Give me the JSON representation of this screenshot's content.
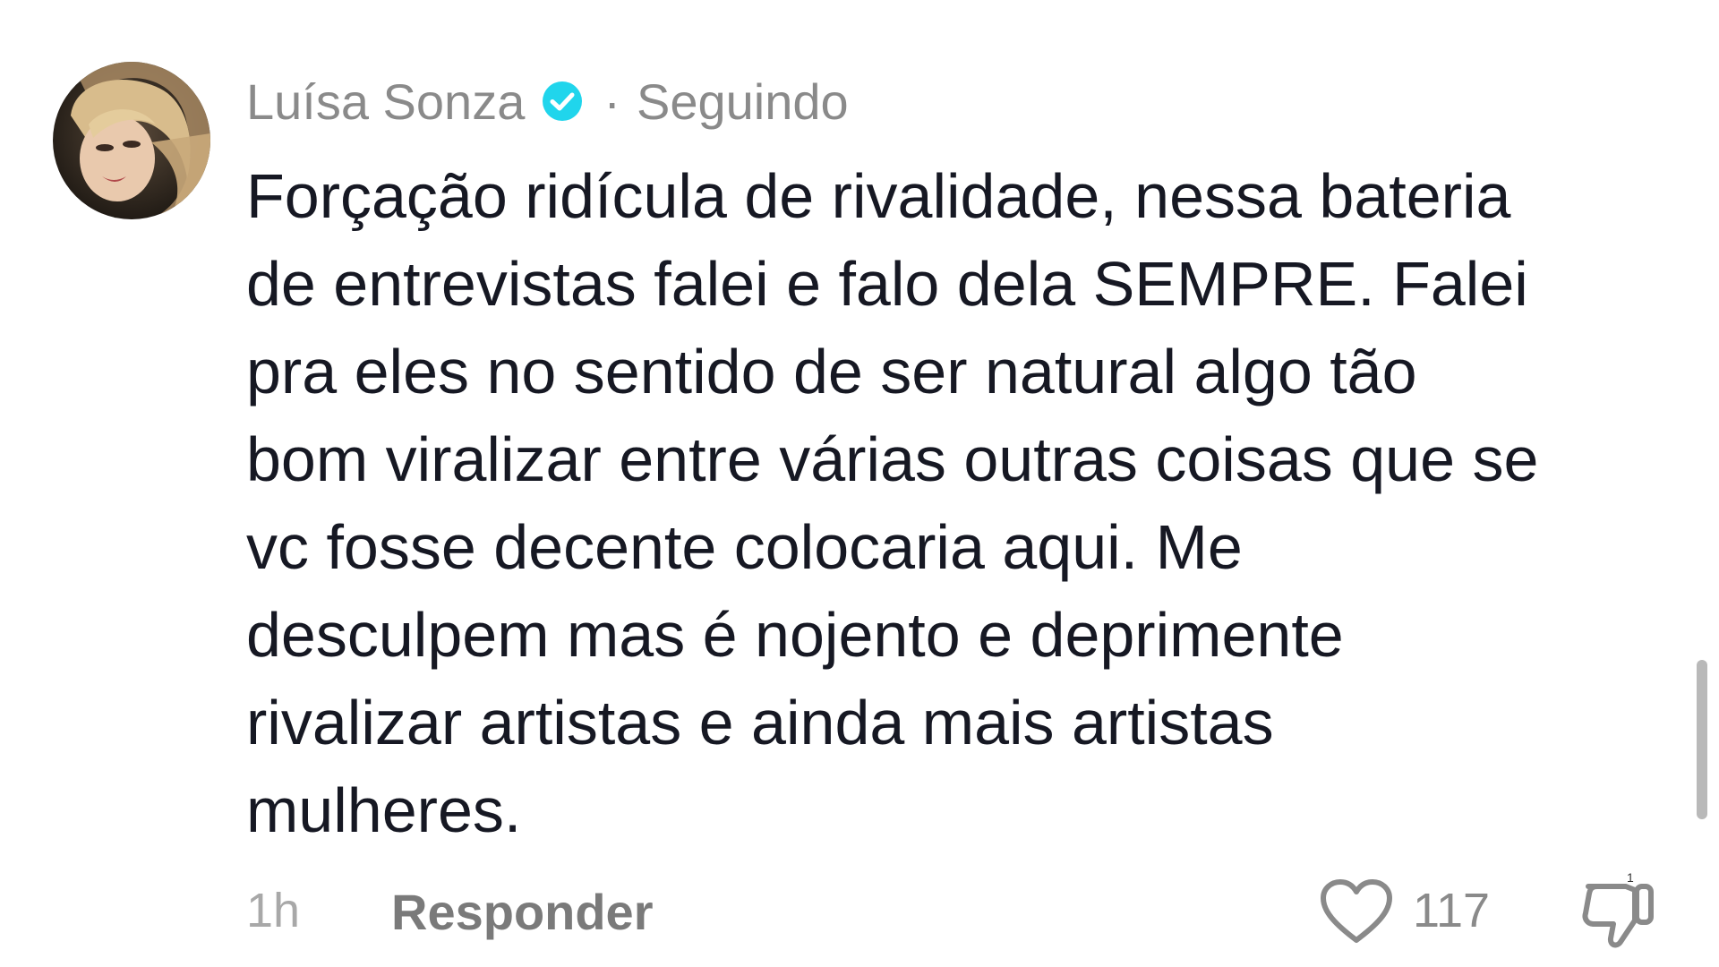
{
  "author": {
    "name": "Luísa Sonza",
    "separator": "·",
    "follow_status": "Seguindo",
    "verified_icon": "verified-check-icon",
    "verified_color": "#20D5EC"
  },
  "comment": {
    "lines": [
      "Forçação ridícula de rivalidade, nessa bateria",
      "de entrevistas falei e falo dela SEMPRE. Falei",
      "pra eles no sentido de ser natural algo tão",
      "bom viralizar entre várias outras coisas que se",
      "vc fosse decente colocaria aqui. Me",
      "desculpem mas é nojento e deprimente",
      "rivalizar artistas e ainda mais artistas",
      "mulheres."
    ]
  },
  "footer": {
    "timestamp": "1h",
    "reply_label": "Responder",
    "like_icon": "heart-outline-icon",
    "like_count": "117",
    "dislike_icon": "thumbs-down-icon",
    "dislike_badge": "1"
  },
  "colors": {
    "text": "#161823",
    "muted": "#8a8a8a",
    "background": "#ffffff"
  }
}
